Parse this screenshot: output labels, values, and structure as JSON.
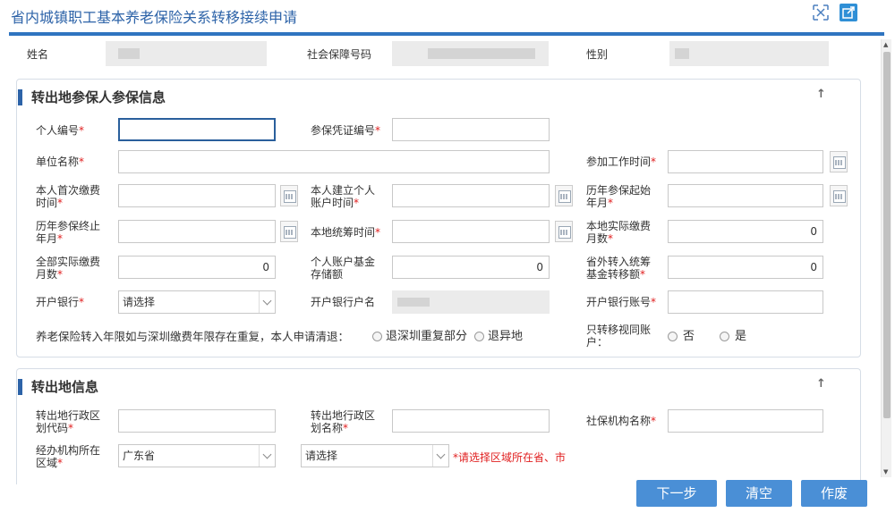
{
  "window": {
    "title": "省内城镇职工基本养老保险关系转移接续申请"
  },
  "icons": {
    "toolbar_left": "crop-expand-icon",
    "toolbar_right": "external-link-icon"
  },
  "header": {
    "name_label": "姓名",
    "ssn_label": "社会保障号码",
    "gender_label": "性别"
  },
  "section1": {
    "title": "转出地参保人参保信息",
    "personal_no_label": "个人编号",
    "certificate_no_label": "参保凭证编号",
    "unit_name_label": "单位名称",
    "work_start_label": "参加工作时间",
    "first_pay_label_1": "本人首次缴费",
    "first_pay_label_2": "时间",
    "account_created_label_1": "本人建立个人",
    "account_created_label_2": "账户时间",
    "history_start_label_1": "历年参保起始",
    "history_start_label_2": "年月",
    "history_end_label_1": "历年参保终止",
    "history_end_label_2": "年月",
    "local_pool_label": "本地统筹时间",
    "local_months_label_1": "本地实际缴费",
    "local_months_label_2": "月数",
    "local_months_value": "0",
    "total_months_label_1": "全部实际缴费",
    "total_months_label_2": "月数",
    "total_months_value": "0",
    "account_fund_label_1": "个人账户基金",
    "account_fund_label_2": "存储额",
    "account_fund_value": "0",
    "external_fund_label_1": "省外转入统筹",
    "external_fund_label_2": "基金转移额",
    "external_fund_value": "0",
    "bank_label": "开户银行",
    "bank_value": "请选择",
    "bank_account_name_label": "开户银行户名",
    "bank_account_no_label": "开户银行账号",
    "overlap_question": "养老保险转入年限如与深圳缴费年限存在重复，本人申请清退：",
    "overlap_opt1": "退深圳重复部分",
    "overlap_opt2": "退异地",
    "only_transfer_label_1": "只转移视同账",
    "only_transfer_label_2": "户：",
    "no_label": "否",
    "yes_label": "是"
  },
  "section2": {
    "title": "转出地信息",
    "region_code_label_1": "转出地行政区",
    "region_code_label_2": "划代码",
    "region_name_label_1": "转出地行政区",
    "region_name_label_2": "划名称",
    "agency_label": "社保机构名称",
    "agency_region_label_1": "经办机构所在",
    "agency_region_label_2": "区域",
    "province_value": "广东省",
    "city_value": "请选择",
    "region_hint": "*请选择区域所在省、市"
  },
  "buttons": {
    "next": "下一步",
    "clear": "清空",
    "void": "作废"
  },
  "colors": {
    "accent": "#2d63a8",
    "button": "#4a8fd6",
    "required": "#e02020"
  }
}
